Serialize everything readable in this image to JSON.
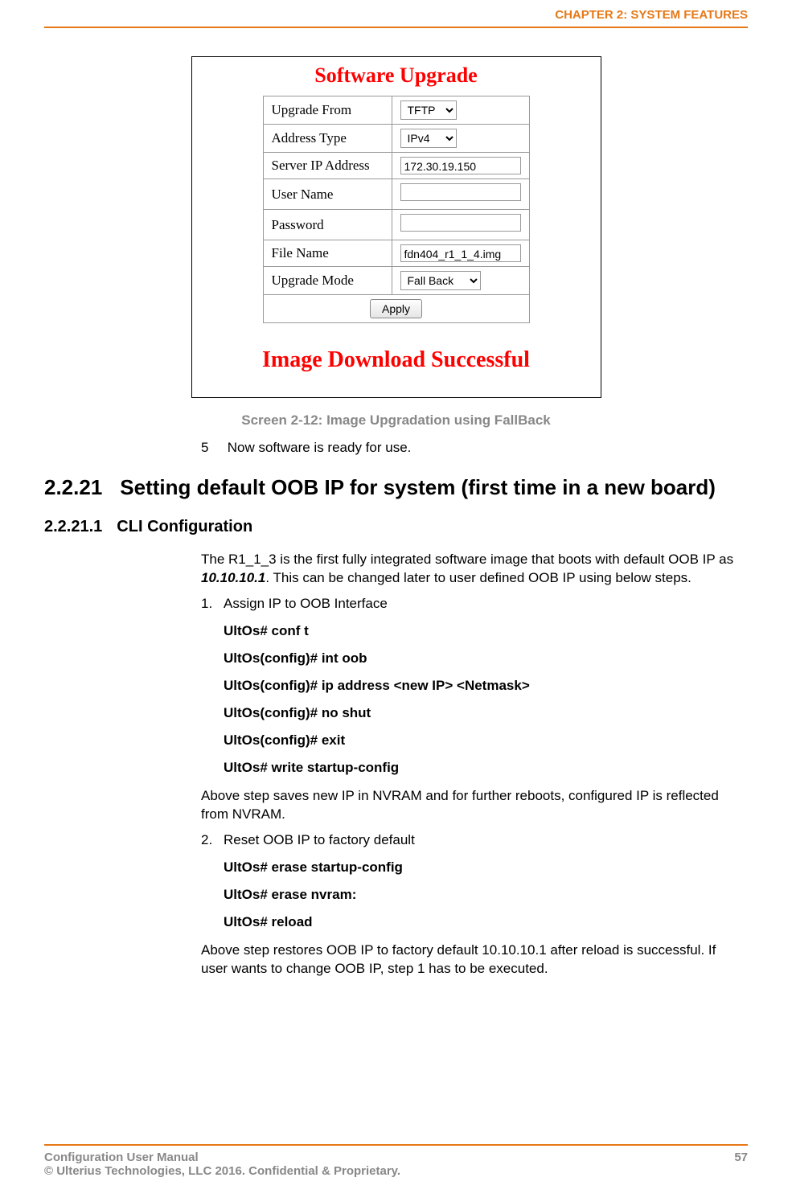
{
  "header": {
    "chapter": "CHAPTER 2: SYSTEM FEATURES"
  },
  "screenshot": {
    "title": "Software Upgrade",
    "fields": {
      "upgrade_from": {
        "label": "Upgrade From",
        "value": "TFTP"
      },
      "address_type": {
        "label": "Address Type",
        "value": "IPv4"
      },
      "server_ip": {
        "label": "Server IP Address",
        "value": "172.30.19.150"
      },
      "user_name": {
        "label": "User Name",
        "value": ""
      },
      "password": {
        "label": "Password",
        "value": ""
      },
      "file_name": {
        "label": "File Name",
        "value": "fdn404_r1_1_4.img"
      },
      "upgrade_mode": {
        "label": "Upgrade Mode",
        "value": "Fall Back"
      }
    },
    "apply_label": "Apply",
    "status": "Image Download Successful"
  },
  "caption": "Screen 2-12: Image Upgradation using FallBack",
  "step5": {
    "num": "5",
    "text": "Now software is ready for use."
  },
  "section": {
    "num": "2.2.21",
    "title": "Setting default OOB IP for system (first time in a new board)"
  },
  "subsection": {
    "num": "2.2.21.1",
    "title": "CLI Configuration"
  },
  "para1_a": "The R1_1_3 is the first fully integrated software image that boots with default OOB IP as ",
  "para1_ip": "10.10.10.1",
  "para1_b": ". This can be changed later to user defined OOB IP using below steps.",
  "list1": {
    "num": "1.",
    "text": "Assign IP to OOB Interface"
  },
  "cli1": [
    "UltOs# conf t",
    "UltOs(config)# int oob",
    "UltOs(config)# ip address  <new IP> <Netmask>",
    "UltOs(config)# no shut",
    "UltOs(config)# exit",
    "UltOs# write startup-config"
  ],
  "para2": "Above step saves new IP in NVRAM and for further reboots, configured   IP is reflected from NVRAM.",
  "list2": {
    "num": "2.",
    "text": "Reset OOB IP to factory default"
  },
  "cli2": [
    "UltOs# erase startup-config",
    "UltOs# erase nvram:",
    "UltOs# reload"
  ],
  "para3": "Above step restores OOB IP to factory default 10.10.10.1 after reload is successful. If user wants to change OOB IP, step 1 has to be executed.",
  "footer": {
    "left": "Configuration User Manual",
    "right": "57",
    "copyright": "© Ulterius Technologies, LLC 2016. Confidential & Proprietary."
  }
}
